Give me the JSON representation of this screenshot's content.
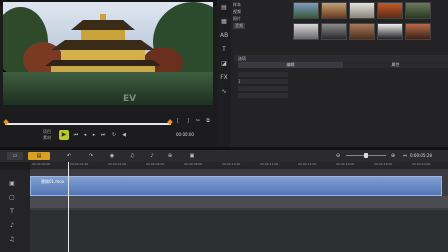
{
  "player": {
    "watermark": "EV",
    "mark_in": "[",
    "mark_out": "]",
    "project_label": "项目",
    "clip_label": "素材",
    "timecode": "00:00:00",
    "play_icon": "play-icon"
  },
  "library": {
    "categories": [
      "样本",
      "视频",
      "照片",
      "音频"
    ],
    "options_title": "选项",
    "tabs": [
      "编辑",
      "属性"
    ],
    "options_value": "1"
  },
  "timeline": {
    "clip_name": "替换01.mov",
    "timecode": "0:00:05:28",
    "ticks": [
      "00:00:00:00",
      "00:00:02:00",
      "00:00:04:00",
      "00:00:06:00",
      "00:00:08:00",
      "00:00:10:00",
      "00:00:12:00",
      "00:00:14:00",
      "00:00:16:00",
      "00:00:18:00",
      "00:00:20:00"
    ]
  },
  "colors": {
    "accent_play": "#b8c826",
    "clip": "#6a8cc8",
    "marker": "#f08c1e"
  }
}
